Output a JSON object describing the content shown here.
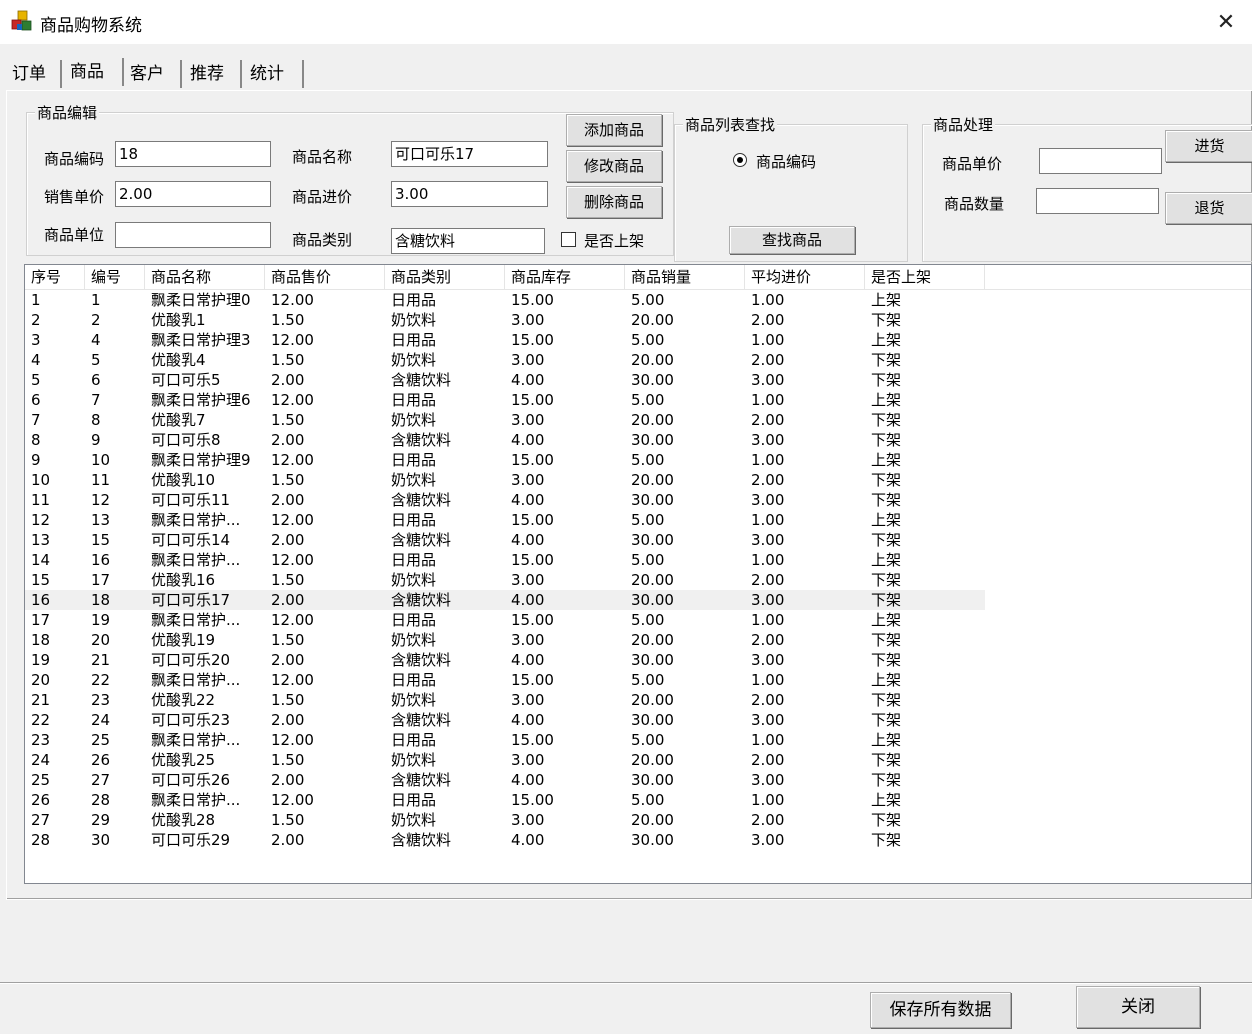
{
  "window": {
    "title": "商品购物系统",
    "close_glyph": "✕",
    "icon": "app-cubes-icon"
  },
  "tabs": [
    "订单",
    "商品",
    "客户",
    "推荐",
    "统计"
  ],
  "active_tab": "商品",
  "edit_group": {
    "legend": "商品编辑",
    "code_label": "商品编码",
    "code_value": "18",
    "name_label": "商品名称",
    "name_value": "可口可乐17",
    "price_label": "销售单价",
    "price_value": "2.00",
    "cost_label": "商品进价",
    "cost_value": "3.00",
    "unit_label": "商品单位",
    "unit_value": "",
    "category_label": "商品类别",
    "category_value": "含糖饮料",
    "on_shelf_label": "是否上架",
    "add_button": "添加商品",
    "modify_button": "修改商品",
    "delete_button": "删除商品"
  },
  "search_group": {
    "legend": "商品列表查找",
    "radio_label": "商品编码",
    "search_button": "查找商品"
  },
  "process_group": {
    "legend": "商品处理",
    "unit_price_label": "商品单价",
    "unit_price_value": "",
    "quantity_label": "商品数量",
    "quantity_value": "",
    "stock_in_button": "进货",
    "return_button": "退货"
  },
  "table": {
    "columns": [
      "序号",
      "编号",
      "商品名称",
      "商品售价",
      "商品类别",
      "商品库存",
      "商品销量",
      "平均进价",
      "是否上架"
    ],
    "selected_row_index": 15,
    "rows": [
      [
        "1",
        "1",
        "飘柔日常护理0",
        "12.00",
        "日用品",
        "15.00",
        "5.00",
        "1.00",
        "上架"
      ],
      [
        "2",
        "2",
        "优酸乳1",
        "1.50",
        "奶饮料",
        "3.00",
        "20.00",
        "2.00",
        "下架"
      ],
      [
        "3",
        "4",
        "飘柔日常护理3",
        "12.00",
        "日用品",
        "15.00",
        "5.00",
        "1.00",
        "上架"
      ],
      [
        "4",
        "5",
        "优酸乳4",
        "1.50",
        "奶饮料",
        "3.00",
        "20.00",
        "2.00",
        "下架"
      ],
      [
        "5",
        "6",
        "可口可乐5",
        "2.00",
        "含糖饮料",
        "4.00",
        "30.00",
        "3.00",
        "下架"
      ],
      [
        "6",
        "7",
        "飘柔日常护理6",
        "12.00",
        "日用品",
        "15.00",
        "5.00",
        "1.00",
        "上架"
      ],
      [
        "7",
        "8",
        "优酸乳7",
        "1.50",
        "奶饮料",
        "3.00",
        "20.00",
        "2.00",
        "下架"
      ],
      [
        "8",
        "9",
        "可口可乐8",
        "2.00",
        "含糖饮料",
        "4.00",
        "30.00",
        "3.00",
        "下架"
      ],
      [
        "9",
        "10",
        "飘柔日常护理9",
        "12.00",
        "日用品",
        "15.00",
        "5.00",
        "1.00",
        "上架"
      ],
      [
        "10",
        "11",
        "优酸乳10",
        "1.50",
        "奶饮料",
        "3.00",
        "20.00",
        "2.00",
        "下架"
      ],
      [
        "11",
        "12",
        "可口可乐11",
        "2.00",
        "含糖饮料",
        "4.00",
        "30.00",
        "3.00",
        "下架"
      ],
      [
        "12",
        "13",
        "飘柔日常护...",
        "12.00",
        "日用品",
        "15.00",
        "5.00",
        "1.00",
        "上架"
      ],
      [
        "13",
        "15",
        "可口可乐14",
        "2.00",
        "含糖饮料",
        "4.00",
        "30.00",
        "3.00",
        "下架"
      ],
      [
        "14",
        "16",
        "飘柔日常护...",
        "12.00",
        "日用品",
        "15.00",
        "5.00",
        "1.00",
        "上架"
      ],
      [
        "15",
        "17",
        "优酸乳16",
        "1.50",
        "奶饮料",
        "3.00",
        "20.00",
        "2.00",
        "下架"
      ],
      [
        "16",
        "18",
        "可口可乐17",
        "2.00",
        "含糖饮料",
        "4.00",
        "30.00",
        "3.00",
        "下架"
      ],
      [
        "17",
        "19",
        "飘柔日常护...",
        "12.00",
        "日用品",
        "15.00",
        "5.00",
        "1.00",
        "上架"
      ],
      [
        "18",
        "20",
        "优酸乳19",
        "1.50",
        "奶饮料",
        "3.00",
        "20.00",
        "2.00",
        "下架"
      ],
      [
        "19",
        "21",
        "可口可乐20",
        "2.00",
        "含糖饮料",
        "4.00",
        "30.00",
        "3.00",
        "下架"
      ],
      [
        "20",
        "22",
        "飘柔日常护...",
        "12.00",
        "日用品",
        "15.00",
        "5.00",
        "1.00",
        "上架"
      ],
      [
        "21",
        "23",
        "优酸乳22",
        "1.50",
        "奶饮料",
        "3.00",
        "20.00",
        "2.00",
        "下架"
      ],
      [
        "22",
        "24",
        "可口可乐23",
        "2.00",
        "含糖饮料",
        "4.00",
        "30.00",
        "3.00",
        "下架"
      ],
      [
        "23",
        "25",
        "飘柔日常护...",
        "12.00",
        "日用品",
        "15.00",
        "5.00",
        "1.00",
        "上架"
      ],
      [
        "24",
        "26",
        "优酸乳25",
        "1.50",
        "奶饮料",
        "3.00",
        "20.00",
        "2.00",
        "下架"
      ],
      [
        "25",
        "27",
        "可口可乐26",
        "2.00",
        "含糖饮料",
        "4.00",
        "30.00",
        "3.00",
        "下架"
      ],
      [
        "26",
        "28",
        "飘柔日常护...",
        "12.00",
        "日用品",
        "15.00",
        "5.00",
        "1.00",
        "上架"
      ],
      [
        "27",
        "29",
        "优酸乳28",
        "1.50",
        "奶饮料",
        "3.00",
        "20.00",
        "2.00",
        "下架"
      ],
      [
        "28",
        "30",
        "可口可乐29",
        "2.00",
        "含糖饮料",
        "4.00",
        "30.00",
        "3.00",
        "下架"
      ]
    ]
  },
  "footer": {
    "save_all_button": "保存所有数据",
    "close_button": "关闭"
  }
}
